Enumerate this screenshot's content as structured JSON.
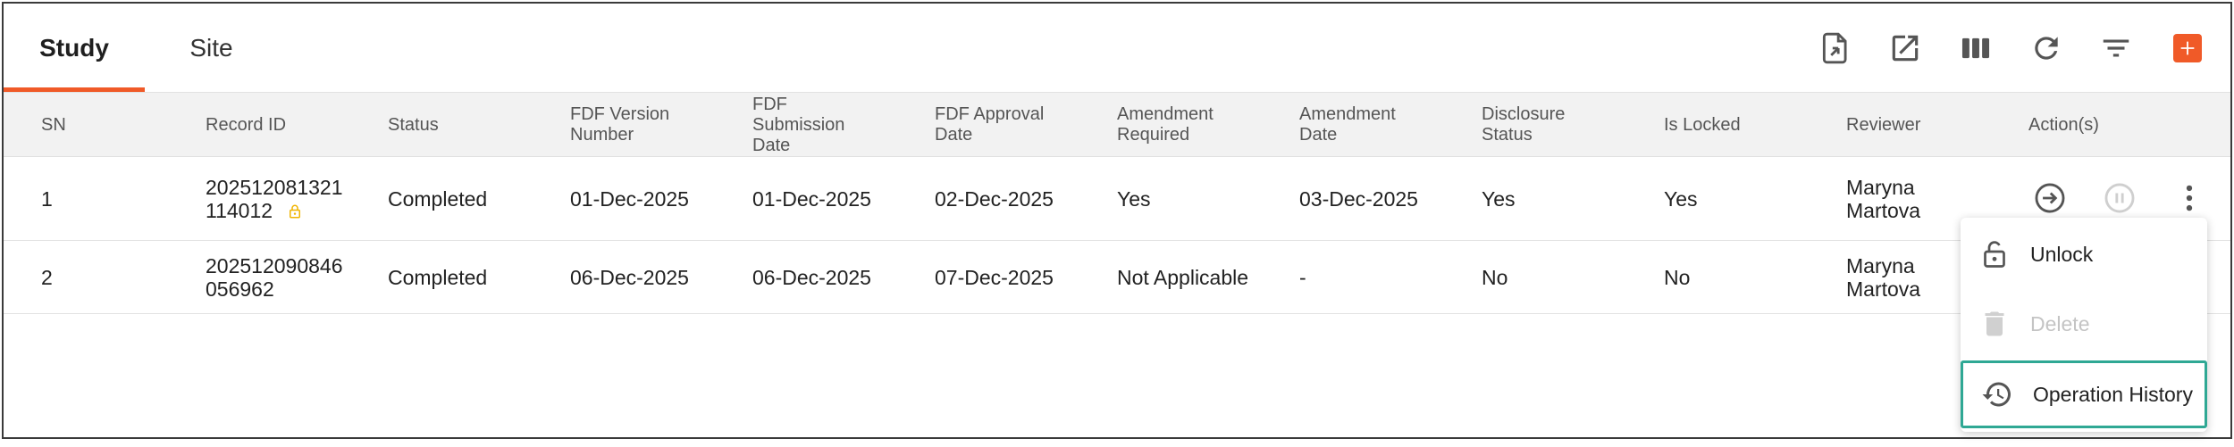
{
  "tabs": [
    {
      "label": "Study",
      "active": true
    },
    {
      "label": "Site",
      "active": false
    }
  ],
  "toolbar": {
    "icons": [
      "export-file-icon",
      "open-external-icon",
      "columns-icon",
      "refresh-icon",
      "filter-icon",
      "add-icon"
    ],
    "accent_color": "#f05a28"
  },
  "table": {
    "headers": {
      "sn": "SN",
      "record_id": "Record ID",
      "status": "Status",
      "fdf_version": "FDF Version Number",
      "fdf_submission": "FDF Submission Date",
      "fdf_approval": "FDF Approval Date",
      "amendment_required": "Amendment Required",
      "amendment_date": "Amendment Date",
      "disclosure_status": "Disclosure Status",
      "is_locked": "Is Locked",
      "reviewer": "Reviewer",
      "actions": "Action(s)"
    },
    "rows": [
      {
        "sn": "1",
        "record_id_line1": "202512081321",
        "record_id_line2": "114012",
        "locked": true,
        "status": "Completed",
        "fdf_version": "01-Dec-2025",
        "fdf_submission": "01-Dec-2025",
        "fdf_approval": "02-Dec-2025",
        "amendment_required": "Yes",
        "amendment_date": "03-Dec-2025",
        "disclosure_status": "Yes",
        "is_locked": "Yes",
        "reviewer_line1": "Maryna",
        "reviewer_line2": "Martova"
      },
      {
        "sn": "2",
        "record_id_line1": "202512090846",
        "record_id_line2": "056962",
        "locked": false,
        "status": "Completed",
        "fdf_version": "06-Dec-2025",
        "fdf_submission": "06-Dec-2025",
        "fdf_approval": "07-Dec-2025",
        "amendment_required": "Not Applicable",
        "amendment_date": "-",
        "disclosure_status": "No",
        "is_locked": "No",
        "reviewer_line1": "Maryna",
        "reviewer_line2": "Martova"
      }
    ]
  },
  "menu": {
    "items": [
      {
        "label": "Unlock",
        "icon": "unlock-icon",
        "disabled": false
      },
      {
        "label": "Delete",
        "icon": "trash-icon",
        "disabled": true
      },
      {
        "label": "Operation History",
        "icon": "history-icon",
        "disabled": false,
        "highlighted": true
      }
    ],
    "highlight_color": "#2fa894"
  }
}
